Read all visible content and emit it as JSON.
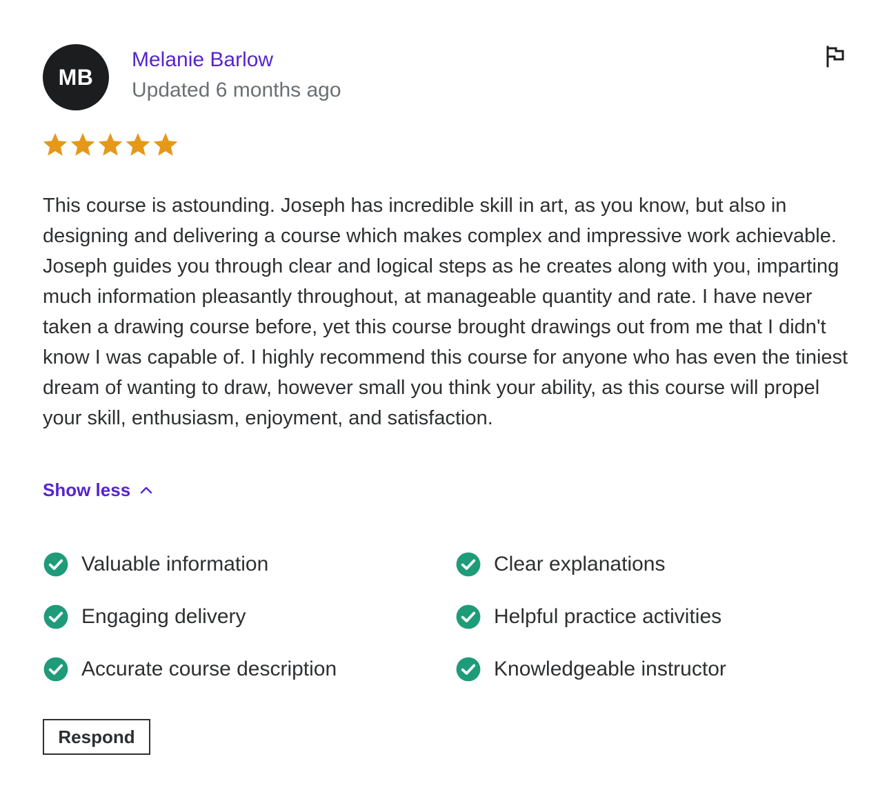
{
  "review": {
    "avatar_initials": "MB",
    "reviewer_name": "Melanie Barlow",
    "updated": "Updated 6 months ago",
    "rating": 5,
    "rating_max": 5,
    "text": "This course is astounding. Joseph has incredible skill in art, as you know, but also in designing and delivering a course which makes complex and impressive work achievable. Joseph guides you through clear and logical steps as he creates along with you, imparting much information pleasantly throughout, at manageable quantity and rate. I have never taken a drawing course before, yet this course brought drawings out from me that I didn't know I was capable of. I highly recommend this course for anyone who has even the tiniest dream of wanting to draw, however small you think your ability, as this course will propel your skill, enthusiasm, enjoyment, and satisfaction.",
    "show_less_label": "Show less",
    "tags": [
      {
        "label": "Valuable information",
        "icon": "check-circle-icon"
      },
      {
        "label": "Clear explanations",
        "icon": "check-circle-icon"
      },
      {
        "label": "Engaging delivery",
        "icon": "check-circle-icon"
      },
      {
        "label": "Helpful practice activities",
        "icon": "check-circle-icon"
      },
      {
        "label": "Accurate course description",
        "icon": "check-circle-icon"
      },
      {
        "label": "Knowledgeable instructor",
        "icon": "check-circle-icon"
      }
    ],
    "respond_label": "Respond"
  },
  "icons": {
    "report": "flag-icon",
    "rating": "star-icon",
    "toggle": "chevron-up-icon"
  },
  "colors": {
    "accent": "#5624d0",
    "star": "#e59819",
    "check": "#1e9c7a",
    "avatar_bg": "#1c1d1f",
    "text": "#2d2f31",
    "muted": "#6a6f73"
  }
}
